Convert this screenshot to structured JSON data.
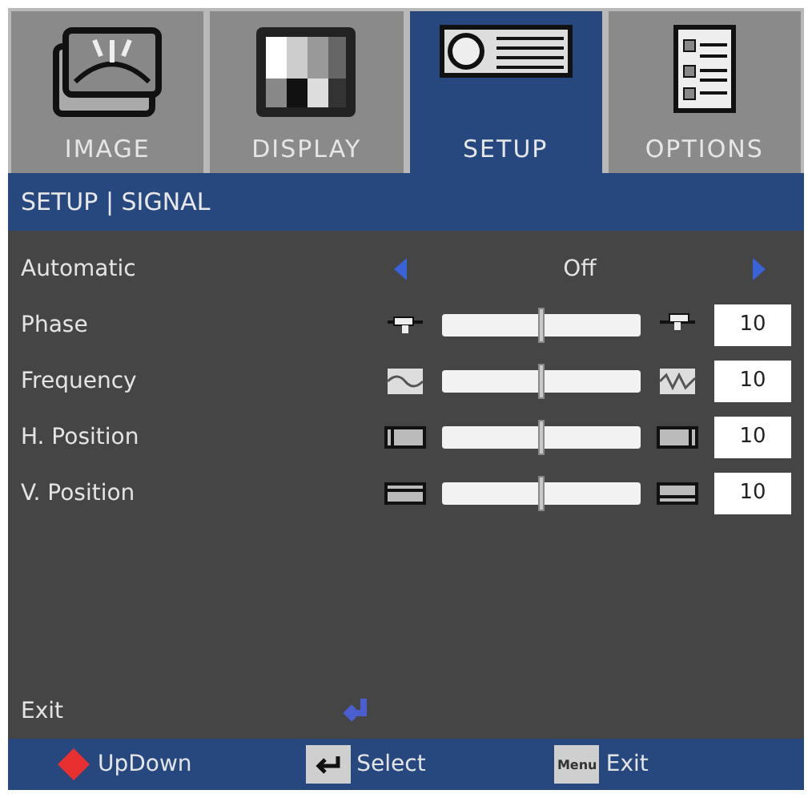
{
  "tabs": [
    {
      "label": "IMAGE",
      "selected": false,
      "kind": "image"
    },
    {
      "label": "DISPLAY",
      "selected": false,
      "kind": "display"
    },
    {
      "label": "SETUP",
      "selected": true,
      "kind": "setup"
    },
    {
      "label": "OPTIONS",
      "selected": false,
      "kind": "options"
    }
  ],
  "header": "SETUP | SIGNAL",
  "rows": [
    {
      "kind": "toggle",
      "label": "Automatic",
      "value": "Off"
    },
    {
      "kind": "slider",
      "label": "Phase",
      "level": 0.5,
      "value": "10"
    },
    {
      "kind": "slider",
      "label": "Frequency",
      "level": 0.5,
      "value": "10"
    },
    {
      "kind": "slider",
      "label": "H. Position",
      "level": 0.5,
      "value": "10"
    },
    {
      "kind": "slider",
      "label": "V. Position",
      "level": 0.5,
      "value": "10"
    }
  ],
  "exit": {
    "label": "Exit"
  },
  "footer": [
    {
      "kind": "updown",
      "label": "UpDown"
    },
    {
      "kind": "enter",
      "label": "Select"
    },
    {
      "kind": "menu",
      "label": "Exit",
      "key": "Menu"
    }
  ]
}
